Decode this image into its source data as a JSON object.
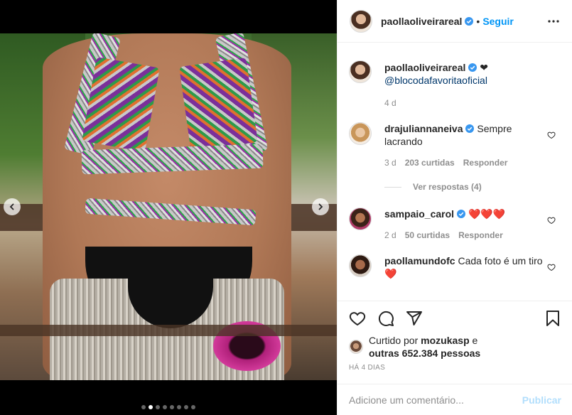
{
  "post": {
    "author": "paollaoliveirareal",
    "follow_sep": "•",
    "follow_label": "Seguir",
    "caption_text": "❤",
    "caption_mention": "@blocodafavoritaoficial",
    "caption_time": "4 d"
  },
  "comments": [
    {
      "user": "drajuliannaneiva",
      "verified": true,
      "text": "Sempre lacrando",
      "time": "3 d",
      "likes": "203 curtidas",
      "reply": "Responder",
      "replies_label": "Ver respostas (4)"
    },
    {
      "user": "sampaio_carol",
      "verified": true,
      "text": "❤️❤️❤️",
      "time": "2 d",
      "likes": "50 curtidas",
      "reply": "Responder"
    },
    {
      "user": "paollamundofc",
      "verified": false,
      "text": "Cada foto é um tiro ❤️"
    }
  ],
  "likes": {
    "prefix": "Curtido por",
    "user": "mozukasp",
    "mid": "e",
    "others": "outras 652.384 pessoas"
  },
  "timestamp": "HÁ 4 DIAS",
  "add_comment": {
    "placeholder": "Adicione um comentário...",
    "publish": "Publicar"
  },
  "carousel": {
    "count": 8,
    "active_index": 1
  },
  "colors": {
    "accent": "#0095f6",
    "text": "#262626",
    "muted": "#8e8e8e",
    "heart": "#ed4956"
  },
  "icons": [
    "more-icon",
    "verified-icon",
    "heart-icon",
    "comment-icon",
    "share-icon",
    "bookmark-icon",
    "chevron-left-icon",
    "chevron-right-icon"
  ]
}
